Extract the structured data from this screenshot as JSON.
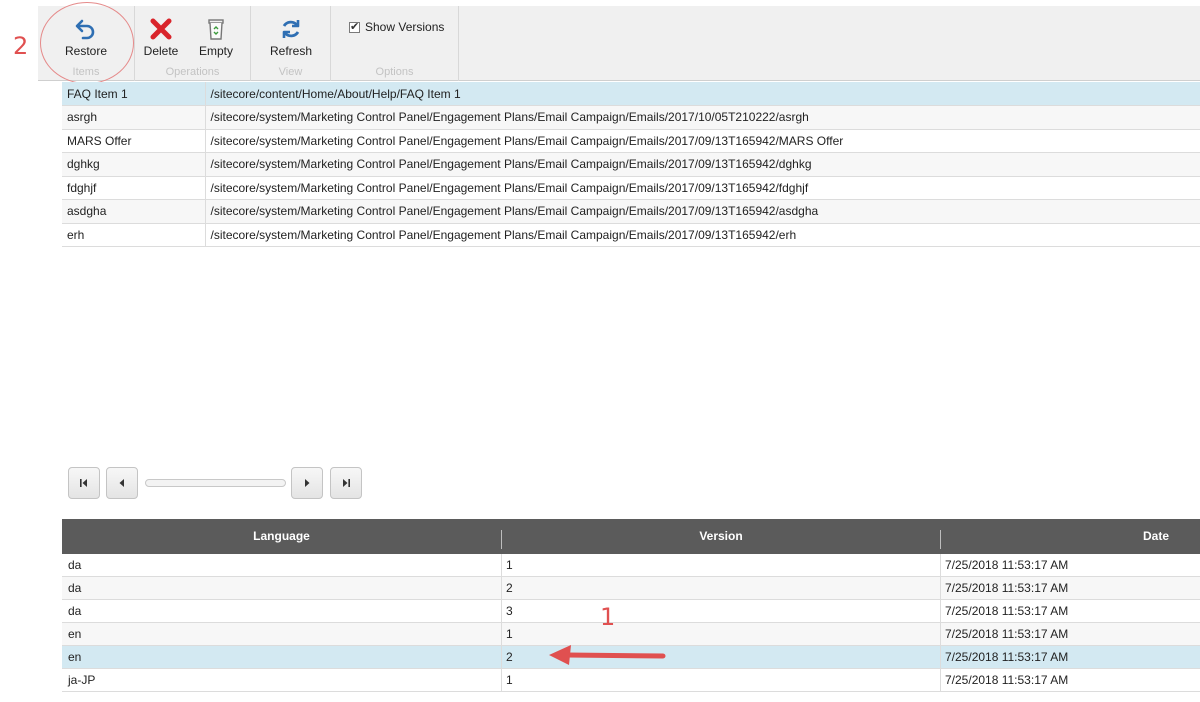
{
  "ribbon": {
    "groups": [
      {
        "label": "Items",
        "buttons": [
          {
            "label": "Restore",
            "icon": "undo-arrow-icon"
          }
        ]
      },
      {
        "label": "Operations",
        "buttons": [
          {
            "label": "Delete",
            "icon": "red-x-icon"
          },
          {
            "label": "Empty",
            "icon": "recycle-bin-icon"
          }
        ]
      },
      {
        "label": "View",
        "buttons": [
          {
            "label": "Refresh",
            "icon": "refresh-arrows-icon"
          }
        ]
      },
      {
        "label": "Options",
        "checkbox": {
          "label": "Show Versions",
          "checked": true
        }
      }
    ]
  },
  "annotations": {
    "circle_number": "2",
    "arrow_number": "1",
    "color": "#e05050"
  },
  "items": [
    {
      "name": "FAQ Item 1",
      "path": "/sitecore/content/Home/About/Help/FAQ Item 1",
      "selected": true
    },
    {
      "name": "asrgh",
      "path": "/sitecore/system/Marketing Control Panel/Engagement Plans/Email Campaign/Emails/2017/10/05T210222/asrgh"
    },
    {
      "name": "MARS Offer",
      "path": "/sitecore/system/Marketing Control Panel/Engagement Plans/Email Campaign/Emails/2017/09/13T165942/MARS Offer"
    },
    {
      "name": "dghkg",
      "path": "/sitecore/system/Marketing Control Panel/Engagement Plans/Email Campaign/Emails/2017/09/13T165942/dghkg"
    },
    {
      "name": "fdghjf",
      "path": "/sitecore/system/Marketing Control Panel/Engagement Plans/Email Campaign/Emails/2017/09/13T165942/fdghjf"
    },
    {
      "name": "asdgha",
      "path": "/sitecore/system/Marketing Control Panel/Engagement Plans/Email Campaign/Emails/2017/09/13T165942/asdgha"
    },
    {
      "name": "erh",
      "path": "/sitecore/system/Marketing Control Panel/Engagement Plans/Email Campaign/Emails/2017/09/13T165942/erh"
    }
  ],
  "pager": {
    "buttons": [
      "first-page-icon",
      "prev-page-icon",
      "next-page-icon",
      "last-page-icon"
    ]
  },
  "versions": {
    "columns": [
      "Language",
      "Version",
      "Date"
    ],
    "rows": [
      {
        "language": "da",
        "version": "1",
        "date": "7/25/2018 11:53:17 AM"
      },
      {
        "language": "da",
        "version": "2",
        "date": "7/25/2018 11:53:17 AM"
      },
      {
        "language": "da",
        "version": "3",
        "date": "7/25/2018 11:53:17 AM"
      },
      {
        "language": "en",
        "version": "1",
        "date": "7/25/2018 11:53:17 AM"
      },
      {
        "language": "en",
        "version": "2",
        "date": "7/25/2018 11:53:17 AM",
        "selected": true
      },
      {
        "language": "ja-JP",
        "version": "1",
        "date": "7/25/2018 11:53:17 AM"
      }
    ]
  },
  "colors": {
    "selected_row": "#d3e9f2",
    "header_bg": "#5b5b5b",
    "ribbon_bg": "#f0f0f0",
    "delete_red": "#d9242b",
    "icon_blue": "#2f6fb3"
  }
}
